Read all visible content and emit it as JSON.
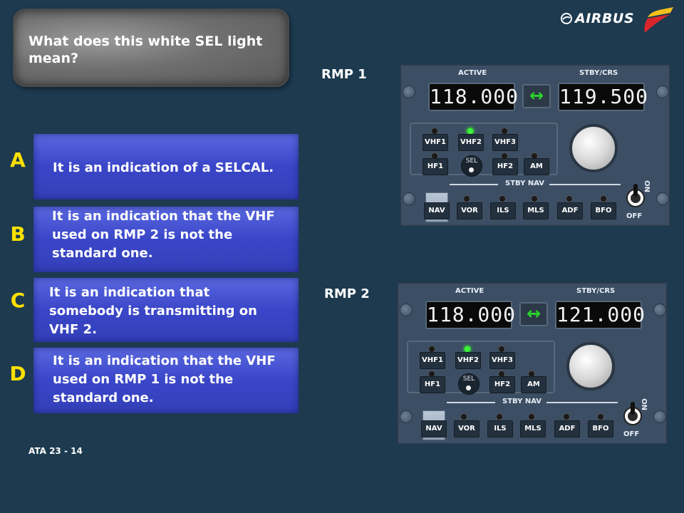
{
  "question": "What does this white SEL light mean?",
  "brand": "AIRBUS",
  "answers": [
    {
      "letter": "A",
      "text": "It is an indication of a SELCAL."
    },
    {
      "letter": "B",
      "text": "It is an indication that the VHF used on RMP 2 is not the standard one."
    },
    {
      "letter": "C",
      "text": "It is an indication that somebody is transmitting on VHF 2."
    },
    {
      "letter": "D",
      "text": "It is an indication that the VHF used on RMP 1 is not the standard one."
    }
  ],
  "footer": "ATA 23 - 14",
  "rmp1": {
    "label": "RMP 1",
    "active_label": "ACTIVE",
    "stby_label": "STBY/CRS",
    "active_freq": "118.000",
    "stby_freq": "119.500",
    "keys": [
      "VHF1",
      "VHF2",
      "VHF3",
      "HF1",
      "HF2",
      "AM"
    ],
    "sel": "SEL",
    "stby_nav": "STBY NAV",
    "nav_keys": [
      "NAV",
      "VOR",
      "ILS",
      "MLS",
      "ADF",
      "BFO"
    ],
    "on": "ON",
    "off": "OFF"
  },
  "rmp2": {
    "label": "RMP 2",
    "active_label": "ACTIVE",
    "stby_label": "STBY/CRS",
    "active_freq": "118.000",
    "stby_freq": "121.000",
    "keys": [
      "VHF1",
      "VHF2",
      "VHF3",
      "HF1",
      "HF2",
      "AM"
    ],
    "sel": "SEL",
    "stby_nav": "STBY NAV",
    "nav_keys": [
      "NAV",
      "VOR",
      "ILS",
      "MLS",
      "ADF",
      "BFO"
    ],
    "on": "ON",
    "off": "OFF"
  },
  "colors": {
    "background": "#1d3a4f",
    "answer_letter": "#ffe100",
    "answer_box": "#3a46c8",
    "led_green": "#3ff23f"
  }
}
